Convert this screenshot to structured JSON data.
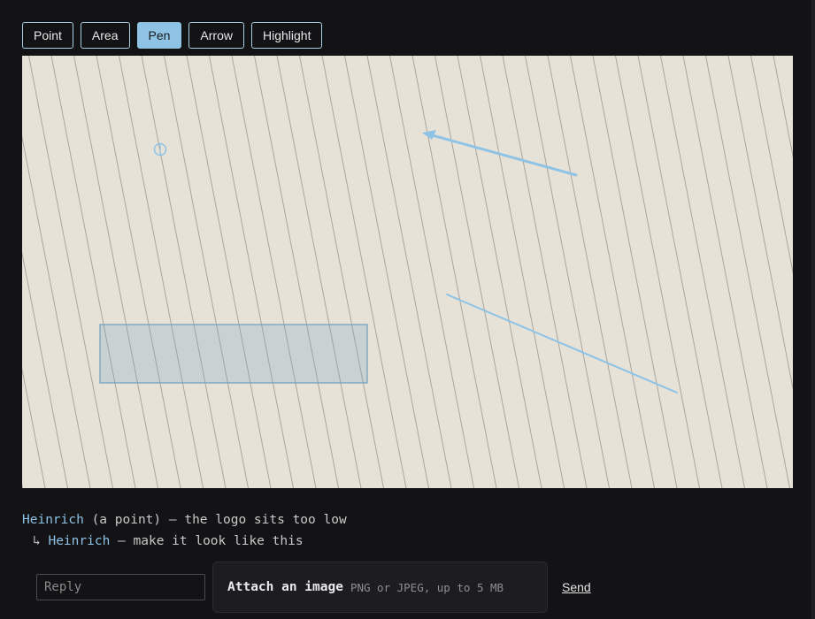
{
  "toolbar": {
    "tools": [
      {
        "label": "Point",
        "active": false
      },
      {
        "label": "Area",
        "active": false
      },
      {
        "label": "Pen",
        "active": true
      },
      {
        "label": "Arrow",
        "active": false
      },
      {
        "label": "Highlight",
        "active": false
      }
    ]
  },
  "canvas": {
    "background_color": "#e7e2d8",
    "stripe_color": "#aaa69d",
    "annotation_color": "#8ec3e6",
    "area_fill": "rgba(110,160,195,0.25)"
  },
  "comments": {
    "thread": {
      "author": "Heinrich",
      "kind": "(a point)",
      "text": "— the logo sits too low"
    },
    "reply": {
      "glyph": "↳",
      "author": "Heinrich",
      "text": "— make it look like this"
    }
  },
  "composer": {
    "reply_placeholder": "Reply",
    "attach_title": "Attach an image",
    "attach_hint": "PNG or JPEG, up to 5 MB",
    "send_label": "Send"
  }
}
